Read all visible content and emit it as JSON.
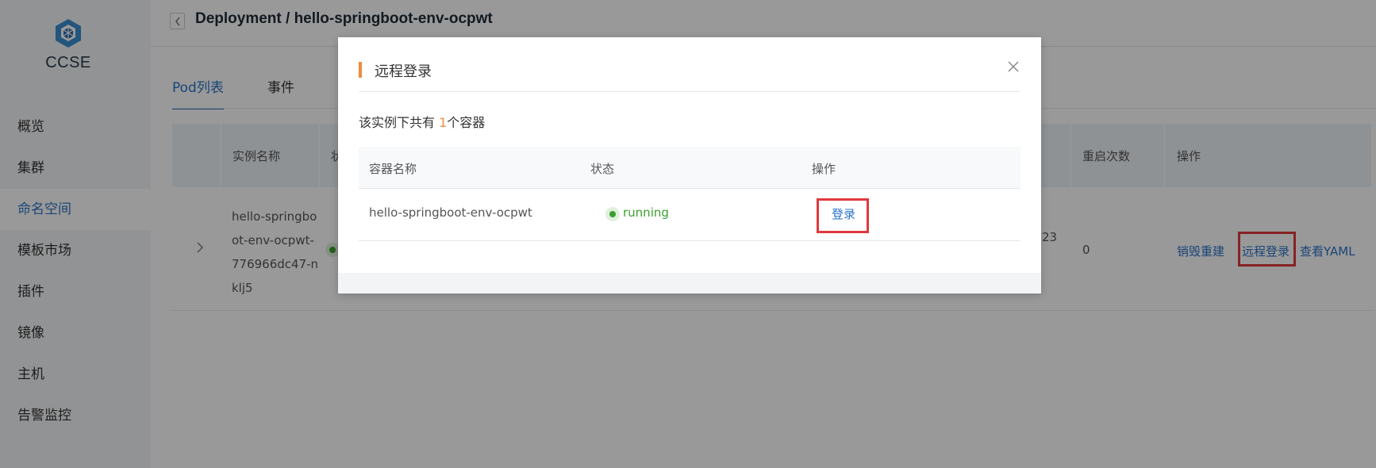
{
  "app": {
    "logo_text": "CCSE"
  },
  "sidebar": {
    "items": [
      {
        "label": "概览"
      },
      {
        "label": "集群"
      },
      {
        "label": "命名空间",
        "active": true
      },
      {
        "label": "模板市场"
      },
      {
        "label": "插件"
      },
      {
        "label": "镜像"
      },
      {
        "label": "主机"
      },
      {
        "label": "告警监控"
      }
    ]
  },
  "header": {
    "breadcrumb": "Deployment / hello-springboot-env-ocpwt"
  },
  "tabs": [
    {
      "label": "Pod列表",
      "active": true
    },
    {
      "label": "事件"
    }
  ],
  "table": {
    "columns": {
      "name": "实例名称",
      "status_partial": "状",
      "restarts": "重启次数",
      "actions": "操作"
    },
    "rows": [
      {
        "name": "hello-springboot-env-ocpwt-776966dc47-nklj5",
        "time_partial": "23",
        "restarts": "0",
        "actions": {
          "destroy": "销毁重建",
          "remote_login": "远程登录",
          "view_yaml": "查看YAML"
        }
      }
    ]
  },
  "modal": {
    "title": "远程登录",
    "info_prefix": "该实例下共有 ",
    "info_count": "1",
    "info_suffix": "个容器",
    "columns": {
      "container": "容器名称",
      "status": "状态",
      "action": "操作"
    },
    "rows": [
      {
        "container": "hello-springboot-env-ocpwt",
        "status": "running",
        "action": "登录"
      }
    ]
  },
  "colors": {
    "accent": "#2b73c8",
    "title_bar": "#f08a3c",
    "running": "#3aa02e",
    "highlight_box": "#e0393e"
  }
}
